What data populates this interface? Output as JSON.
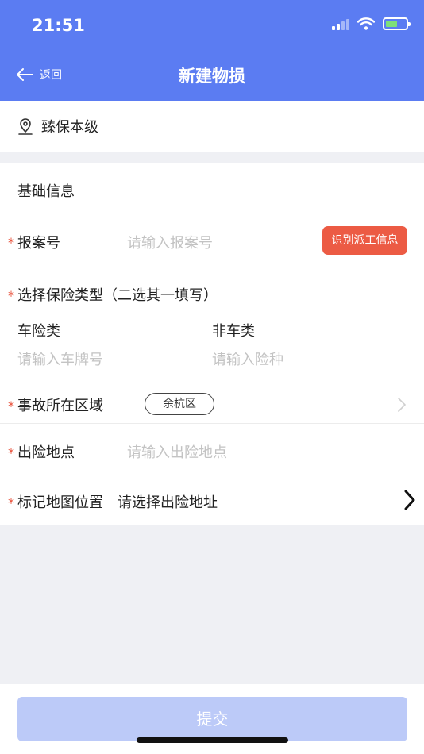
{
  "status_bar": {
    "time": "21:51"
  },
  "nav": {
    "back_label": "返回",
    "title": "新建物损"
  },
  "org": {
    "name": "臻保本级"
  },
  "section": {
    "title": "基础信息"
  },
  "fields": {
    "case_no": {
      "label": "报案号",
      "placeholder": "请输入报案号",
      "action": "识别派工信息"
    },
    "insurance_type": {
      "label": "选择保险类型（二选其一填写）",
      "vehicle": {
        "label": "车险类",
        "placeholder": "请输入车牌号"
      },
      "non_vehicle": {
        "label": "非车类",
        "placeholder": "请输入险种"
      }
    },
    "area": {
      "label": "事故所在区域",
      "value": "余杭区"
    },
    "location": {
      "label": "出险地点",
      "placeholder": "请输入出险地点"
    },
    "map": {
      "label": "标记地图位置",
      "value": "请选择出险地址"
    }
  },
  "footer": {
    "submit_label": "提交"
  },
  "colors": {
    "primary": "#5b7cf2",
    "danger": "#ec5b44",
    "submit_disabled": "#bccaf8"
  }
}
